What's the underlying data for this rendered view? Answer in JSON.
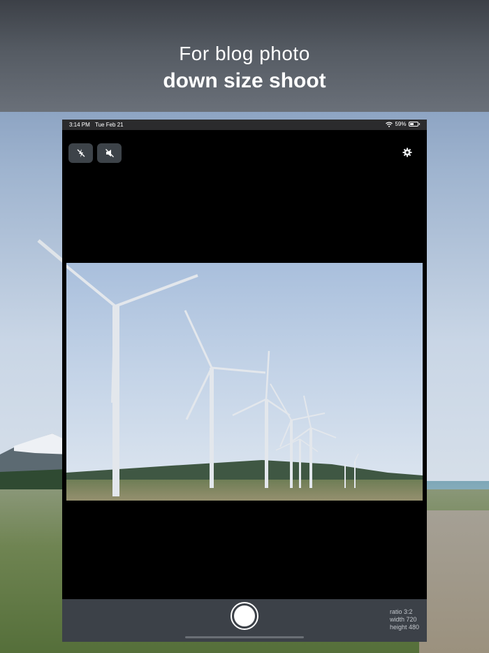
{
  "banner": {
    "line1": "For blog photo",
    "line2": "down size shoot"
  },
  "status_bar": {
    "time": "3:14 PM",
    "date": "Tue Feb 21",
    "battery_percent_text": "59%",
    "battery_level": 0.59,
    "icons": [
      "wifi-icon",
      "battery-icon"
    ]
  },
  "camera_controls": {
    "flash_icon": "flash-off-icon",
    "sound_icon": "sound-off-icon",
    "settings_icon": "gear-icon"
  },
  "capture_info": {
    "ratio": "ratio 3:2",
    "width": "width 720",
    "height": "height 480"
  },
  "colors": {
    "button_bg": "#3d4349",
    "bottom_bar": "#3c4148",
    "status_bar": "#2b2b2d"
  }
}
